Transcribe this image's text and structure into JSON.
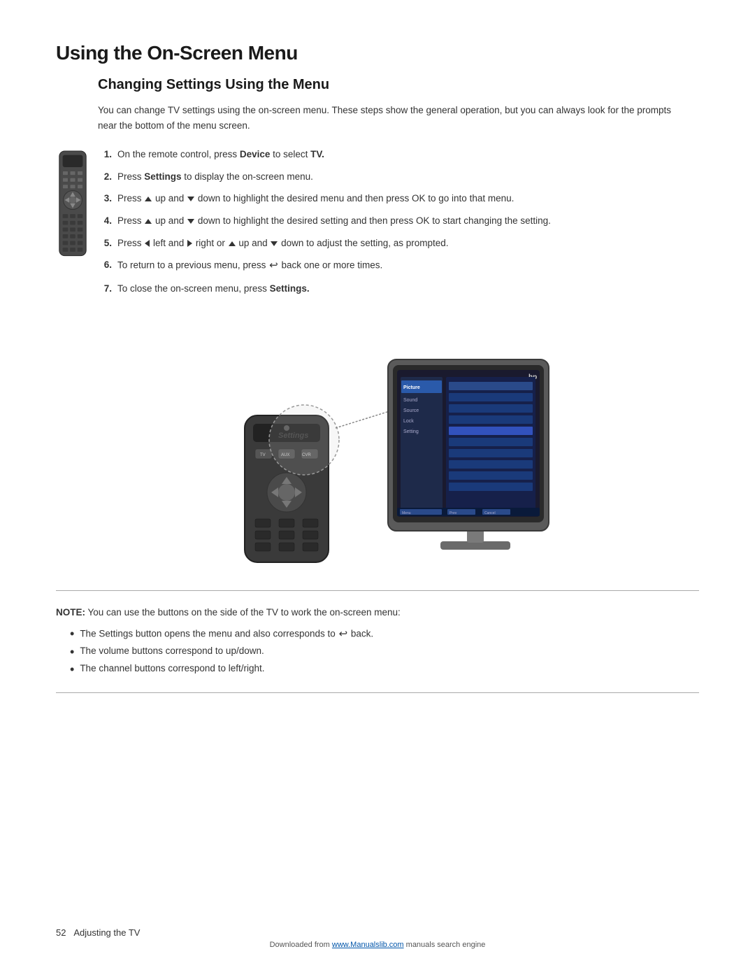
{
  "page": {
    "title": "Using the On-Screen Menu",
    "section_title": "Changing Settings Using the Menu",
    "intro": "You can change TV settings using the on-screen menu. These steps show the general operation, but you can always look for the prompts near the bottom of the menu screen.",
    "steps": [
      {
        "num": "1.",
        "text_parts": [
          {
            "t": "On the remote control, press ",
            "bold": false
          },
          {
            "t": "Device",
            "bold": true
          },
          {
            "t": " to select ",
            "bold": false
          },
          {
            "t": "TV.",
            "bold": true
          }
        ]
      },
      {
        "num": "2.",
        "text_parts": [
          {
            "t": "Press ",
            "bold": false
          },
          {
            "t": "Settings",
            "bold": true
          },
          {
            "t": " to display the on-screen menu.",
            "bold": false
          }
        ]
      },
      {
        "num": "3.",
        "text_parts": [
          {
            "t": "Press ",
            "bold": false
          },
          {
            "t": "up",
            "arrow": "up"
          },
          {
            "t": " up and ",
            "bold": false
          },
          {
            "t": "down",
            "arrow": "down"
          },
          {
            "t": " down to highlight the desired menu and then press OK to go into that menu.",
            "bold": false
          }
        ]
      },
      {
        "num": "4.",
        "text_parts": [
          {
            "t": "Press ",
            "bold": false
          },
          {
            "t": "up",
            "arrow": "up"
          },
          {
            "t": " up and ",
            "bold": false
          },
          {
            "t": "down",
            "arrow": "down"
          },
          {
            "t": " down to highlight the desired setting and then press OK to start changing the setting.",
            "bold": false
          }
        ]
      },
      {
        "num": "5.",
        "text_parts": [
          {
            "t": "Press ",
            "bold": false
          },
          {
            "t": "left",
            "arrow": "left"
          },
          {
            "t": " left and ",
            "bold": false
          },
          {
            "t": "right",
            "arrow": "right"
          },
          {
            "t": " right or ",
            "bold": false
          },
          {
            "t": "up",
            "arrow": "up"
          },
          {
            "t": " up and ",
            "bold": false
          },
          {
            "t": "down",
            "arrow": "down"
          },
          {
            "t": " down to adjust the setting, as prompted.",
            "bold": false
          }
        ]
      },
      {
        "num": "6.",
        "text_parts": [
          {
            "t": "To return to a previous menu, press ",
            "bold": false
          },
          {
            "t": "back",
            "arrow": "back"
          },
          {
            "t": " back one or more times.",
            "bold": false
          }
        ]
      },
      {
        "num": "7.",
        "text_parts": [
          {
            "t": "To close the on-screen menu, press ",
            "bold": false
          },
          {
            "t": "Settings.",
            "bold": true
          }
        ]
      }
    ],
    "note_label": "NOTE:",
    "note_text": "You can use the buttons on the side of the TV to work the on-screen menu:",
    "bullets": [
      {
        "text_parts": [
          {
            "t": "The Settings button opens the menu and also corresponds to ",
            "bold": false
          },
          {
            "t": "back",
            "arrow": "back"
          },
          {
            "t": " back.",
            "bold": false
          }
        ]
      },
      {
        "text": "The volume buttons correspond to up/down.",
        "bold": false
      },
      {
        "text": "The channel buttons correspond to left/right.",
        "bold": false
      }
    ],
    "footer": {
      "page_num": "52",
      "page_label": "Adjusting the TV",
      "download_text": "Downloaded from ",
      "download_link_text": "www.Manualslib.com",
      "download_link_url": "http://www.manualslib.com",
      "download_suffix": " manuals search engine"
    }
  }
}
